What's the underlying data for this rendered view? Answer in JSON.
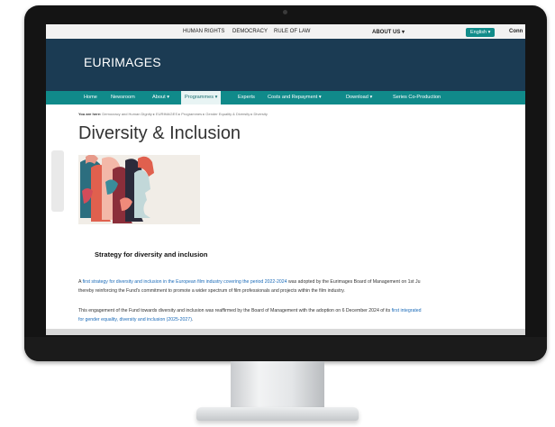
{
  "topbar": {
    "links": [
      "HUMAN RIGHTS",
      "DEMOCRACY",
      "RULE OF LAW"
    ],
    "about": "ABOUT US",
    "language": "English",
    "connect": "Conn"
  },
  "header": {
    "brand": "EURIMAGES"
  },
  "nav": {
    "items": [
      {
        "label": "Home"
      },
      {
        "label": "Newsroom"
      },
      {
        "label": "About"
      },
      {
        "label": "Programmes"
      },
      {
        "label": "Experts"
      },
      {
        "label": "Costs and Repayment"
      },
      {
        "label": "Download"
      },
      {
        "label": "Series Co-Production"
      }
    ]
  },
  "breadcrumb": {
    "prefix": "You are here:",
    "items": [
      "Democracy and Human Dignity",
      "EURIMAGES",
      "Programmes",
      "Gender Equality & Diversity",
      "Diversity"
    ]
  },
  "page": {
    "title": "Diversity & Inclusion",
    "heading": "Strategy for diversity and inclusion",
    "p1": {
      "a": "A ",
      "link": "first strategy for diversity and inclusion in the European film industry covering the period 2022-2024",
      "b": " was adopted by the Eurimages Board of Management on 1st Ju",
      "line2": "thereby reinforcing the Fund's commitment to promote a wider spectrum of film professionals and projects within the film industry."
    },
    "p2": {
      "a": "This engagement of the Fund towards diversity and inclusion was reaffirmed by the Board of Management with the adoption on 6 December 2024 of its ",
      "link": "first integrated",
      "link2": "for gender equality, diversity and inclusion (2025-2027)",
      "end": "."
    }
  },
  "icons": {
    "chevron": "chevron-down-icon"
  },
  "colors": {
    "header": "#1b3b53",
    "nav": "#108a8a",
    "accent": "#118c8a",
    "link": "#1a6ab8"
  }
}
